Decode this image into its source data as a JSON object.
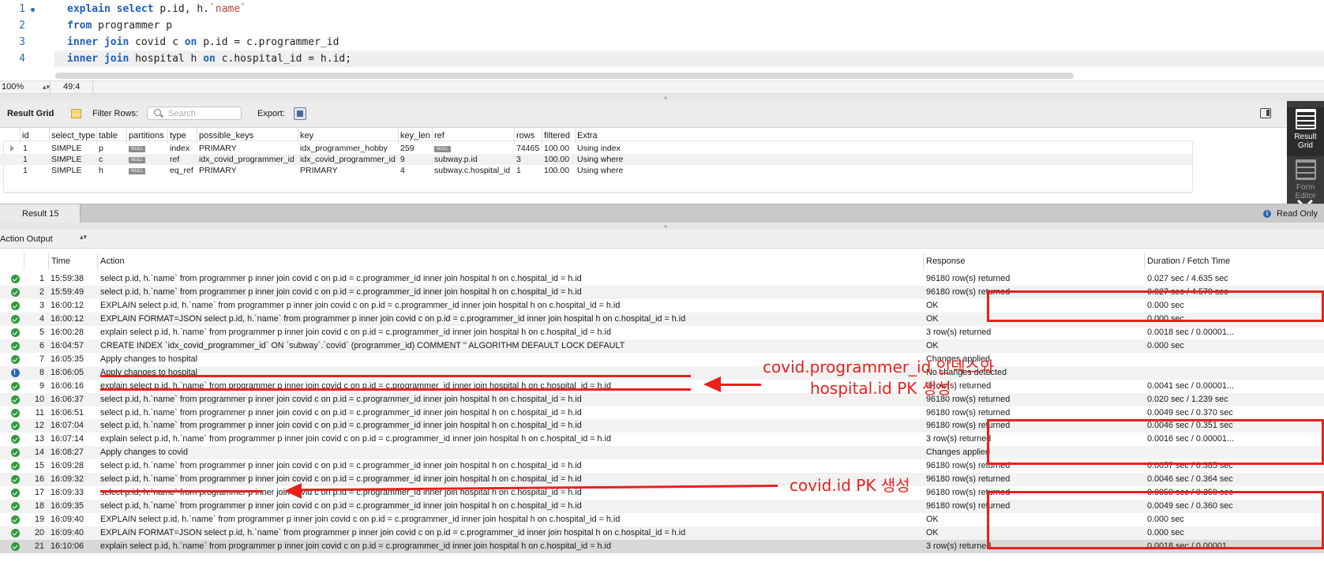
{
  "editor": {
    "lines": [
      {
        "num": "1",
        "segments": [
          [
            "kw",
            "explain"
          ],
          [
            "t",
            " "
          ],
          [
            "kw",
            "select"
          ],
          [
            "t",
            " p.id, h."
          ],
          [
            "str",
            "`name`"
          ]
        ]
      },
      {
        "num": "2",
        "segments": [
          [
            "kw",
            "from"
          ],
          [
            "t",
            " programmer p"
          ]
        ]
      },
      {
        "num": "3",
        "segments": [
          [
            "kw",
            "inner join"
          ],
          [
            "t",
            " covid c "
          ],
          [
            "kw",
            "on"
          ],
          [
            "t",
            " p.id = c.programmer_id"
          ]
        ]
      },
      {
        "num": "4",
        "segments": [
          [
            "kw",
            "inner join"
          ],
          [
            "t",
            " hospital h "
          ],
          [
            "kw",
            "on"
          ],
          [
            "t",
            " c.hospital_id = h.id;"
          ]
        ]
      }
    ],
    "zoom": "100%",
    "cursor_pos": "49:4"
  },
  "result_toolbar": {
    "title": "Result Grid",
    "filter_label": "Filter Rows:",
    "search_placeholder": "Search",
    "export_label": "Export:"
  },
  "sidebar": {
    "result_grid_label": "Result\nGrid",
    "form_editor_label": "Form\nEditor"
  },
  "result_grid": {
    "columns": [
      "id",
      "select_type",
      "table",
      "partitions",
      "type",
      "possible_keys",
      "key",
      "key_len",
      "ref",
      "rows",
      "filtered",
      "Extra"
    ],
    "rows": [
      [
        "1",
        "SIMPLE",
        "p",
        "NULL",
        "index",
        "PRIMARY",
        "idx_programmer_hobby",
        "259",
        "NULL",
        "74465",
        "100.00",
        "Using index"
      ],
      [
        "1",
        "SIMPLE",
        "c",
        "NULL",
        "ref",
        "idx_covid_programmer_id",
        "idx_covid_programmer_id",
        "9",
        "subway.p.id",
        "3",
        "100.00",
        "Using where"
      ],
      [
        "1",
        "SIMPLE",
        "h",
        "NULL",
        "eq_ref",
        "PRIMARY",
        "PRIMARY",
        "4",
        "subway.c.hospital_id",
        "1",
        "100.00",
        "Using where"
      ]
    ]
  },
  "tabs": {
    "active": "Result 15",
    "read_only": "Read Only"
  },
  "output": {
    "selector": "Action Output",
    "columns": {
      "time": "Time",
      "action": "Action",
      "response": "Response",
      "duration": "Duration / Fetch Time"
    },
    "rows": [
      {
        "n": "1",
        "status": "ok",
        "time": "15:59:38",
        "action": "select p.id, h.`name`   from programmer p   inner join covid c on p.id = c.programmer_id   inner join hospital h on c.hospital_id = h.id",
        "response": "96180 row(s) returned",
        "duration": "0.027 sec / 4.635 sec"
      },
      {
        "n": "2",
        "status": "ok",
        "time": "15:59:49",
        "action": "select p.id, h.`name`   from programmer p   inner join covid c on p.id = c.programmer_id   inner join hospital h on c.hospital_id = h.id",
        "response": "96180 row(s) returned",
        "duration": "0.027 sec / 4.579 sec"
      },
      {
        "n": "3",
        "status": "ok",
        "time": "16:00:12",
        "action": "EXPLAIN select p.id, h.`name`   from programmer p   inner join covid c on p.id = c.programmer_id   inner join hospital h on c.hospital_id = h.id",
        "response": "OK",
        "duration": "0.000 sec"
      },
      {
        "n": "4",
        "status": "ok",
        "time": "16:00:12",
        "action": "EXPLAIN FORMAT=JSON select p.id, h.`name`   from programmer p   inner join covid c on p.id = c.programmer_id   inner join hospital h on c.hospital_id = h.id",
        "response": "OK",
        "duration": "0.000 sec"
      },
      {
        "n": "5",
        "status": "ok",
        "time": "16:00:28",
        "action": "explain select p.id, h.`name`   from programmer p   inner join covid c on p.id = c.programmer_id   inner join hospital h on c.hospital_id = h.id",
        "response": "3 row(s) returned",
        "duration": "0.0018 sec / 0.00001..."
      },
      {
        "n": "6",
        "status": "ok",
        "time": "16:04:57",
        "action": "CREATE INDEX `idx_covid_programmer_id`  ON `subway`.`covid` (programmer_id) COMMENT '' ALGORITHM DEFAULT LOCK DEFAULT",
        "response": "OK",
        "duration": "0.000 sec"
      },
      {
        "n": "7",
        "status": "ok",
        "time": "16:05:35",
        "action": "Apply changes to hospital",
        "response": "Changes applied",
        "duration": ""
      },
      {
        "n": "8",
        "status": "info",
        "time": "16:06:05",
        "action": "Apply changes to hospital",
        "response": "No changes detected",
        "duration": ""
      },
      {
        "n": "9",
        "status": "ok",
        "time": "16:06:16",
        "action": "explain select p.id, h.`name`   from programmer p   inner join covid c on p.id = c.programmer_id   inner join hospital h on c.hospital_id = h.id",
        "response": "3 row(s) returned",
        "duration": "0.0041 sec / 0.00001..."
      },
      {
        "n": "10",
        "status": "ok",
        "time": "16:06:37",
        "action": "select p.id, h.`name`   from programmer p   inner join covid c on p.id = c.programmer_id   inner join hospital h on c.hospital_id = h.id",
        "response": "96180 row(s) returned",
        "duration": "0.020 sec / 1.239 sec"
      },
      {
        "n": "11",
        "status": "ok",
        "time": "16:06:51",
        "action": "select p.id, h.`name`   from programmer p   inner join covid c on p.id = c.programmer_id   inner join hospital h on c.hospital_id = h.id",
        "response": "96180 row(s) returned",
        "duration": "0.0049 sec / 0.370 sec"
      },
      {
        "n": "12",
        "status": "ok",
        "time": "16:07:04",
        "action": "select p.id, h.`name`   from programmer p   inner join covid c on p.id = c.programmer_id   inner join hospital h on c.hospital_id = h.id",
        "response": "96180 row(s) returned",
        "duration": "0.0046 sec / 0.351 sec"
      },
      {
        "n": "13",
        "status": "ok",
        "time": "16:07:14",
        "action": "explain select p.id, h.`name`   from programmer p   inner join covid c on p.id = c.programmer_id   inner join hospital h on c.hospital_id = h.id",
        "response": "3 row(s) returned",
        "duration": "0.0016 sec / 0.00001..."
      },
      {
        "n": "14",
        "status": "ok",
        "time": "16:08:27",
        "action": "Apply changes to covid",
        "response": "Changes applied",
        "duration": ""
      },
      {
        "n": "15",
        "status": "ok",
        "time": "16:09:28",
        "action": "select p.id, h.`name`   from programmer p   inner join covid c on p.id = c.programmer_id   inner join hospital h on c.hospital_id = h.id",
        "response": "96180 row(s) returned",
        "duration": "0.0057 sec / 0.385 sec"
      },
      {
        "n": "16",
        "status": "ok",
        "time": "16:09:32",
        "action": "select p.id, h.`name`   from programmer p   inner join covid c on p.id = c.programmer_id   inner join hospital h on c.hospital_id = h.id",
        "response": "96180 row(s) returned",
        "duration": "0.0046 sec / 0.364 sec"
      },
      {
        "n": "17",
        "status": "ok",
        "time": "16:09:33",
        "action": "select p.id, h.`name`   from programmer p   inner join covid c on p.id = c.programmer_id   inner join hospital h on c.hospital_id = h.id",
        "response": "96180 row(s) returned",
        "duration": "0.0050 sec / 0.359 sec"
      },
      {
        "n": "18",
        "status": "ok",
        "time": "16:09:35",
        "action": "select p.id, h.`name`   from programmer p   inner join covid c on p.id = c.programmer_id   inner join hospital h on c.hospital_id = h.id",
        "response": "96180 row(s) returned",
        "duration": "0.0049 sec / 0.360 sec"
      },
      {
        "n": "19",
        "status": "ok",
        "time": "16:09:40",
        "action": "EXPLAIN select p.id, h.`name`   from programmer p   inner join covid c on p.id = c.programmer_id   inner join hospital h on c.hospital_id = h.id",
        "response": "OK",
        "duration": "0.000 sec"
      },
      {
        "n": "20",
        "status": "ok",
        "time": "16:09:40",
        "action": "EXPLAIN FORMAT=JSON select p.id, h.`name`   from programmer p   inner join covid c on p.id = c.programmer_id   inner join hospital h on c.hospital_id = h.id",
        "response": "OK",
        "duration": "0.000 sec"
      },
      {
        "n": "21",
        "status": "ok",
        "time": "16:10:06",
        "action": "explain select p.id, h.`name`   from programmer p   inner join covid c on p.id = c.programmer_id   inner join hospital h on c.hospital_id = h.id",
        "response": "3 row(s) returned",
        "duration": "0.0018 sec / 0.00001..."
      }
    ]
  },
  "annotations": {
    "note1_line1": "covid.programmer_id 인덱스와",
    "note1_line2": "hospital.id PK 생성",
    "note2": "covid.id PK 생성",
    "color": "#e8211d"
  }
}
